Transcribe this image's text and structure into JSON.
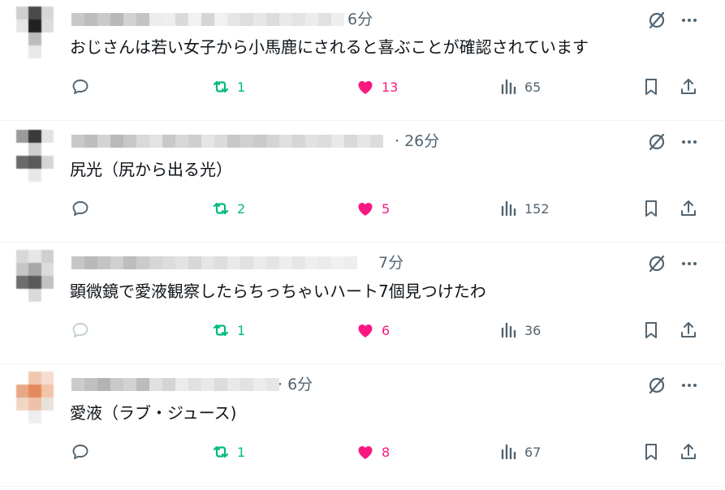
{
  "colors": {
    "text": "#0f1419",
    "muted": "#536471",
    "retweet": "#00ba7c",
    "like": "#f91880",
    "divider": "#eff3f4"
  },
  "icons": {
    "reply": "reply-icon",
    "retweet": "retweet-icon",
    "like": "heart-icon",
    "views": "views-icon",
    "bookmark": "bookmark-icon",
    "share": "share-icon",
    "grok": "grok-icon",
    "more": "more-icon"
  },
  "posts": [
    {
      "time": "6分",
      "text": "おじさんは若い女子から小馬鹿にされると喜ぶことが確認されています",
      "retweets": "1",
      "likes": "13",
      "views": "65"
    },
    {
      "time": "· 26分",
      "text": "尻光（尻から出る光）",
      "retweets": "2",
      "likes": "5",
      "views": "152"
    },
    {
      "time": "7分",
      "text": "顕微鏡で愛液観察したらちっちゃいハート7個見つけたわ",
      "retweets": "1",
      "likes": "6",
      "views": "36"
    },
    {
      "time": "· 6分",
      "text": "愛液（ラブ・ジュース)",
      "retweets": "1",
      "likes": "8",
      "views": "67"
    }
  ]
}
